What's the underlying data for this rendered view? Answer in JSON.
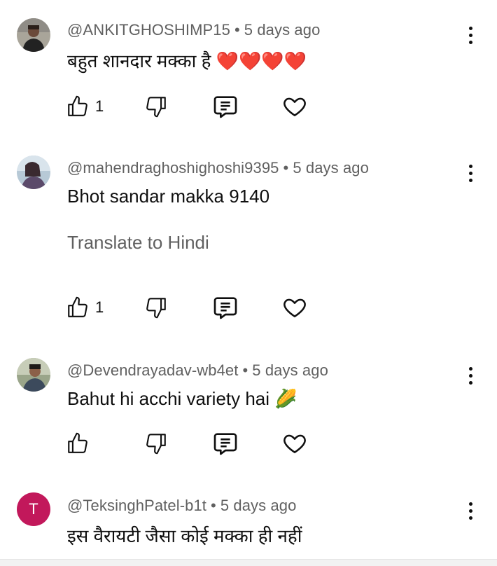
{
  "comments": [
    {
      "handle": "@ANKITGHOSHIMP15",
      "separator": "•",
      "time": "5 days ago",
      "text": "बहुत शानदार मक्का है ❤️❤️❤️❤️",
      "likes": "1",
      "avatar_icon": "user-photo"
    },
    {
      "handle": "@mahendraghoshighoshi9395",
      "separator": "•",
      "time": "5 days ago",
      "text": "Bhot sandar makka 9140",
      "translate": "Translate to Hindi",
      "likes": "1",
      "avatar_icon": "user-photo"
    },
    {
      "handle": "@Devendrayadav-wb4et",
      "separator": "•",
      "time": "5 days ago",
      "text": "Bahut hi acchi variety hai 🌽",
      "likes": "",
      "avatar_icon": "user-photo"
    },
    {
      "handle": "@TeksinghPatel-b1t",
      "separator": "•",
      "time": "5 days ago",
      "text": "इस वैरायटी जैसा कोई मक्का ही नहीं",
      "avatar_letter": "T",
      "avatar_color": "#c2185b"
    }
  ],
  "icons": {
    "like": "thumbs-up-icon",
    "dislike": "thumbs-down-icon",
    "reply": "reply-icon",
    "heart": "heart-icon",
    "more": "more-vert-icon"
  }
}
